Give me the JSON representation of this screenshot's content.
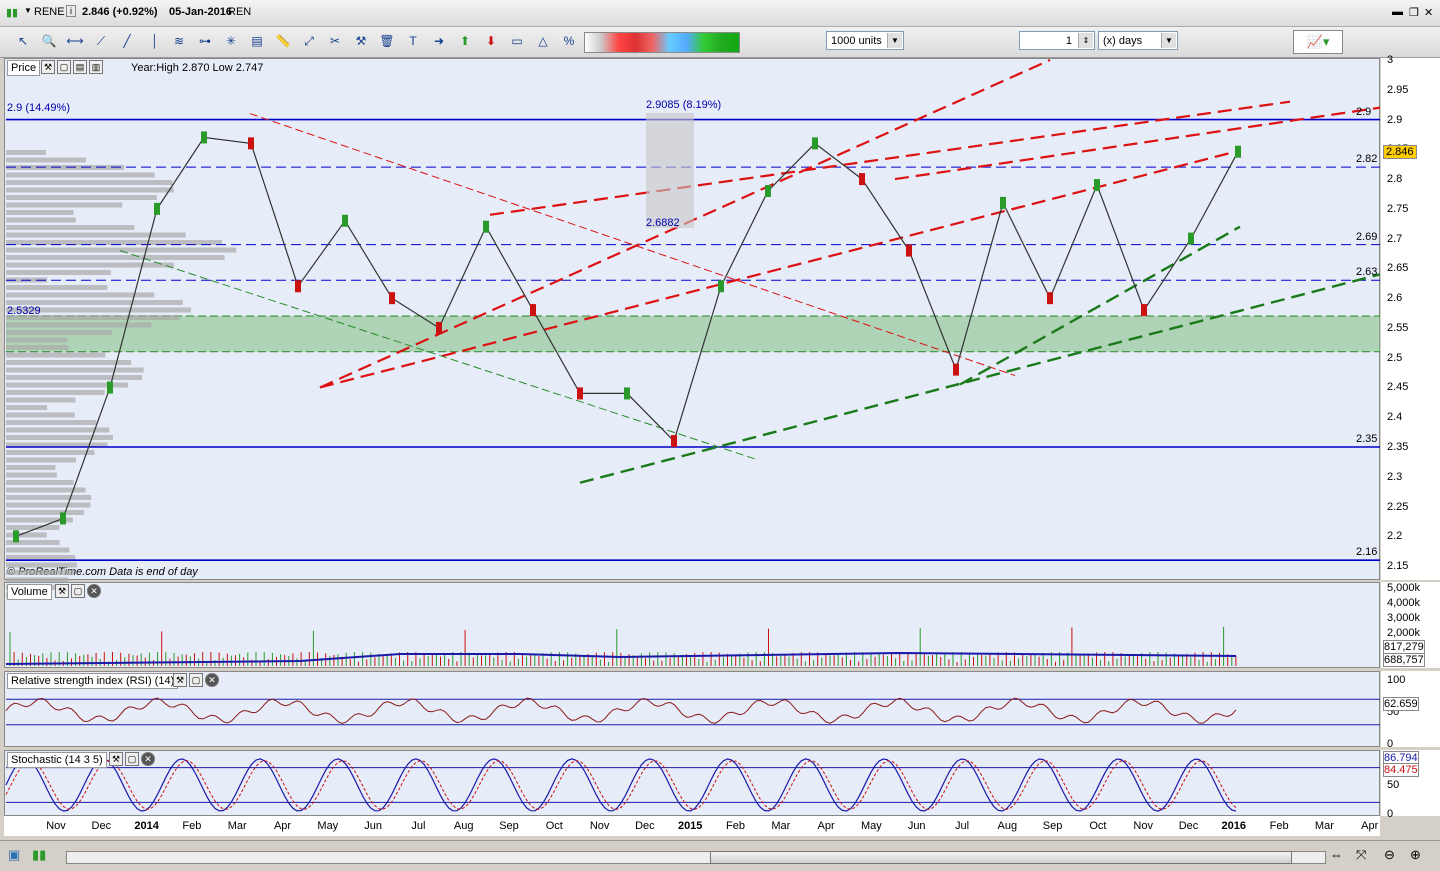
{
  "window": {
    "symbol": "RENE",
    "price": "2.846 (+0.92%)",
    "date": "05-Jan-2016",
    "name": "REN"
  },
  "toolbar": {
    "units": "1000 units",
    "period_value": "1",
    "period_unit": "(x) days"
  },
  "price_panel": {
    "label": "Price",
    "year_info": "Year:High 2.870 Low 2.747",
    "credit": "© ProRealTime.com  Data is end of day",
    "annotations": {
      "left_top": "2.9 (14.49%)",
      "mid_top": "2.9085 (8.19%)",
      "mid_low": "2.6882",
      "left_low": "2.5329"
    },
    "level_labels": [
      "2.9",
      "2.82",
      "2.69",
      "2.63",
      "2.35",
      "2.16"
    ],
    "current_price": "2.846",
    "y_ticks": [
      "3",
      "2.95",
      "2.9",
      "2.85",
      "2.8",
      "2.75",
      "2.7",
      "2.65",
      "2.6",
      "2.55",
      "2.5",
      "2.45",
      "2.4",
      "2.35",
      "2.3",
      "2.25",
      "2.2",
      "2.15"
    ]
  },
  "volume_panel": {
    "label": "Volume",
    "y_ticks": [
      "5,000k",
      "4,000k",
      "3,000k",
      "2,000k",
      "1,000k"
    ],
    "values": [
      "817,279",
      "688,757"
    ]
  },
  "rsi_panel": {
    "label": "Relative strength index (RSI) (14)",
    "y_ticks": [
      "100",
      "50",
      "0"
    ],
    "value": "62.659"
  },
  "stoch_panel": {
    "label": "Stochastic (14 3 5)",
    "y_ticks": [
      "100",
      "50",
      "0"
    ],
    "values": [
      "86.794",
      "84.475"
    ]
  },
  "date_axis": [
    "Nov",
    "Dec",
    "2014",
    "Feb",
    "Mar",
    "Apr",
    "May",
    "Jun",
    "Jul",
    "Aug",
    "Sep",
    "Oct",
    "Nov",
    "Dec",
    "2015",
    "Feb",
    "Mar",
    "Apr",
    "May",
    "Jun",
    "Jul",
    "Aug",
    "Sep",
    "Oct",
    "Nov",
    "Dec",
    "2016",
    "Feb",
    "Mar",
    "Apr"
  ],
  "colors": {
    "panel_bg": "#e6ecf8",
    "up": "#2a9a2a",
    "down": "#cc1111",
    "level": "#0000cc",
    "zone": "#7fc07f"
  },
  "chart_data": {
    "type": "line",
    "title": "RENE",
    "x": [
      "2013-11",
      "2013-12",
      "2014-01",
      "2014-02",
      "2014-03",
      "2014-04",
      "2014-05",
      "2014-06",
      "2014-07",
      "2014-08",
      "2014-09",
      "2014-10",
      "2014-11",
      "2014-12",
      "2015-01",
      "2015-02",
      "2015-03",
      "2015-04",
      "2015-05",
      "2015-06",
      "2015-07",
      "2015-08",
      "2015-09",
      "2015-10",
      "2015-11",
      "2015-12",
      "2016-01"
    ],
    "series": [
      {
        "name": "Price",
        "values": [
          2.2,
          2.23,
          2.45,
          2.75,
          2.87,
          2.86,
          2.62,
          2.73,
          2.6,
          2.55,
          2.72,
          2.58,
          2.44,
          2.44,
          2.36,
          2.62,
          2.78,
          2.86,
          2.8,
          2.68,
          2.48,
          2.76,
          2.6,
          2.79,
          2.58,
          2.7,
          2.846
        ]
      }
    ],
    "levels": [
      2.9,
      2.82,
      2.69,
      2.63,
      2.35,
      2.16
    ],
    "zone": [
      2.51,
      2.57
    ],
    "ylim": [
      2.13,
      3.0
    ],
    "xlabel": "",
    "ylabel": ""
  }
}
